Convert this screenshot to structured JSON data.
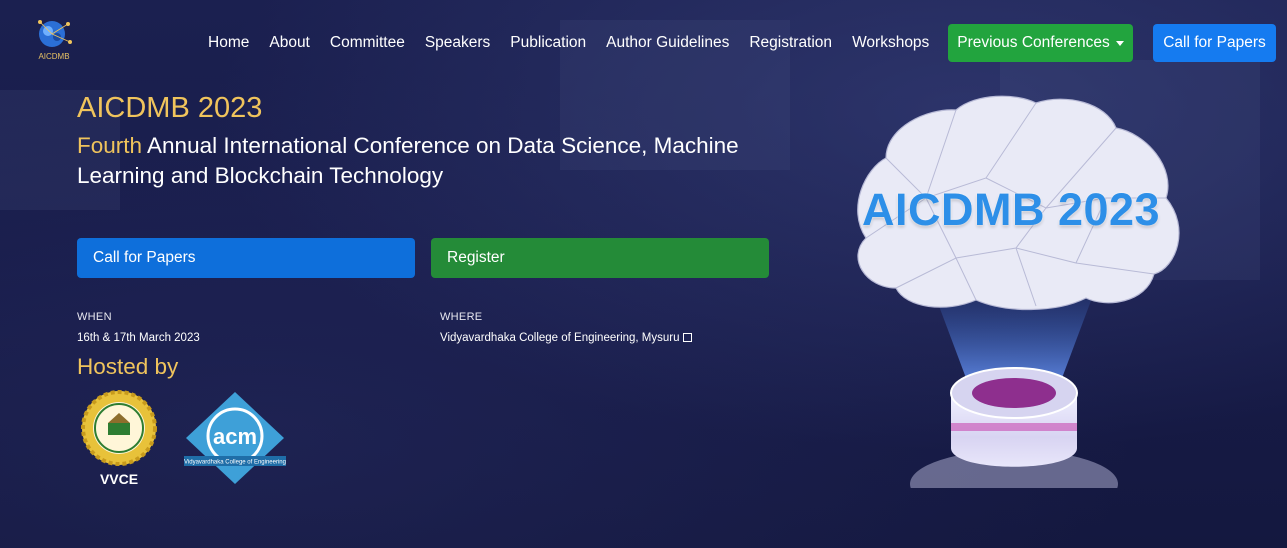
{
  "nav": {
    "logo_text": "AICDMB",
    "links": [
      "Home",
      "About",
      "Committee",
      "Speakers",
      "Publication",
      "Author Guidelines",
      "Registration",
      "Workshops"
    ],
    "previous_conferences": "Previous Conferences",
    "call_for_papers": "Call for Papers"
  },
  "hero": {
    "title": "AICDMB 2023",
    "subtitle_highlight": "Fourth",
    "subtitle_rest": " Annual International Conference on Data Science, Machine Learning and Blockchain Technology",
    "cfp_button": "Call for Papers",
    "register_button": "Register",
    "when_label": "WHEN",
    "when_value": "16th & 17th March 2023",
    "where_label": "WHERE",
    "where_value": "Vidyavardhaka College of Engineering, Mysuru",
    "hosted_by": "Hosted by",
    "vvce_label": "VVCE",
    "acm_text": "acm",
    "acm_subtext": "Vidyavardhaka College of Engineering",
    "brain_text": "AICDMB 2023"
  },
  "colors": {
    "background": "#171b4a",
    "gold": "#f0c45c",
    "green": "#22a43e",
    "blue": "#157bf0"
  }
}
